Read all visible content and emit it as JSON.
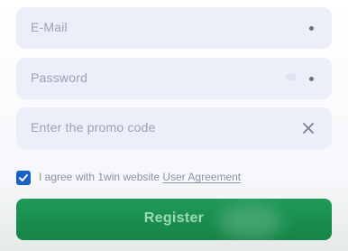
{
  "form": {
    "email": {
      "placeholder": "E-Mail",
      "value": ""
    },
    "password": {
      "placeholder": "Password",
      "value": ""
    },
    "promo": {
      "placeholder": "Enter the promo code",
      "value": ""
    }
  },
  "agreement": {
    "checked": true,
    "text": "I agree with 1win website",
    "link_label": "User Agreement"
  },
  "register_button": {
    "label": "Register"
  },
  "icons": {
    "email_status": "dot-indicator",
    "password_visibility": "eye-icon",
    "password_status": "dot-indicator",
    "promo_clear": "close-icon",
    "checkbox": "check-icon"
  },
  "colors": {
    "field_bg": "#eceff9",
    "checkbox": "#1b60c9",
    "button": "#1f9a58"
  }
}
